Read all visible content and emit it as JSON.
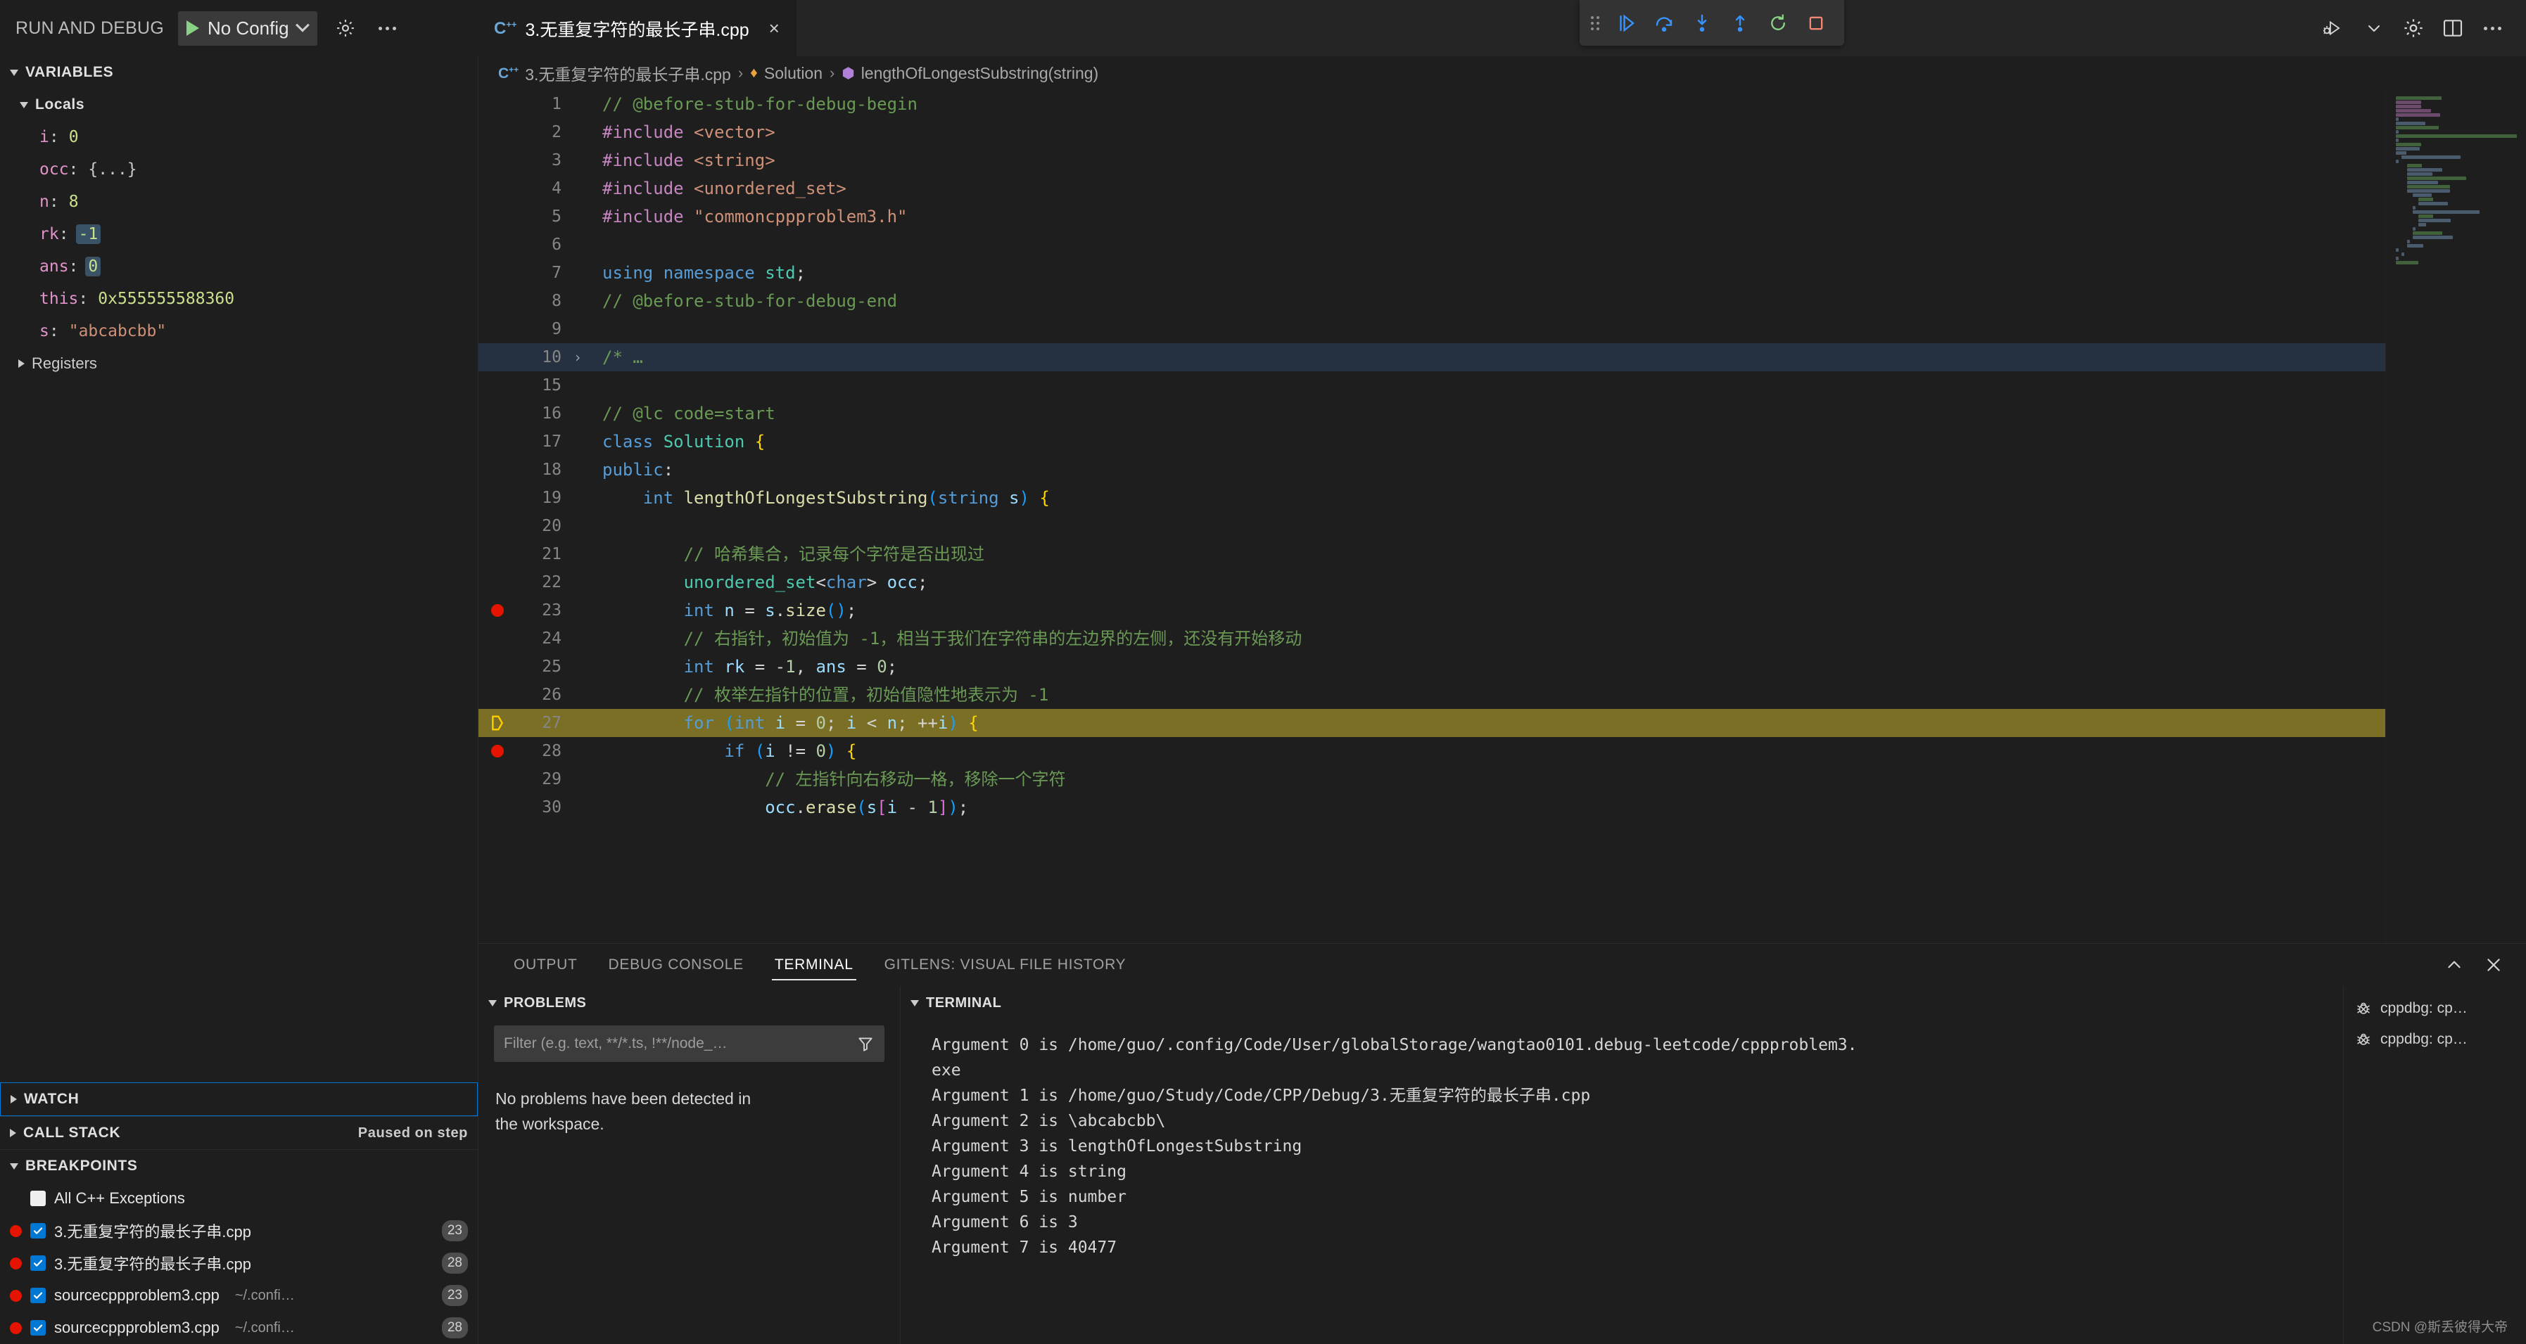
{
  "debug_header": {
    "title": "RUN AND DEBUG",
    "config_label": "No Config",
    "play_icon": "play-icon",
    "gear_icon": "gear-icon",
    "more_icon": "more-actions-icon"
  },
  "tab": {
    "label": "3.无重复字符的最长子串.cpp",
    "icon": "cpp-file-icon",
    "close": "×"
  },
  "debug_toolbar": {
    "buttons": [
      {
        "name": "drag-handle",
        "title": ""
      },
      {
        "name": "continue-button",
        "title": "Continue"
      },
      {
        "name": "step-over-button",
        "title": "Step Over"
      },
      {
        "name": "step-into-button",
        "title": "Step Into"
      },
      {
        "name": "step-out-button",
        "title": "Step Out"
      },
      {
        "name": "restart-button",
        "title": "Restart"
      },
      {
        "name": "stop-button",
        "title": "Stop"
      }
    ]
  },
  "top_right_icons": [
    {
      "name": "run-and-debug-icon"
    },
    {
      "name": "chevron-down-icon"
    },
    {
      "name": "settings-gear-icon"
    },
    {
      "name": "split-editor-icon"
    },
    {
      "name": "more-actions-icon"
    }
  ],
  "sidebar": {
    "variables_title": "VARIABLES",
    "locals_title": "Locals",
    "registers_title": "Registers",
    "locals": [
      {
        "name": "i",
        "value": "0",
        "kind": "num",
        "changed": false
      },
      {
        "name": "occ",
        "value": "{...}",
        "kind": "obj",
        "changed": false
      },
      {
        "name": "n",
        "value": "8",
        "kind": "num",
        "changed": false
      },
      {
        "name": "rk",
        "value": "-1",
        "kind": "num",
        "changed": true
      },
      {
        "name": "ans",
        "value": "0",
        "kind": "num",
        "changed": true
      },
      {
        "name": "this",
        "value": "0x555555588360",
        "kind": "num",
        "changed": false
      },
      {
        "name": "s",
        "value": "\"abcabcbb\"",
        "kind": "str",
        "changed": false
      }
    ],
    "watch_title": "WATCH",
    "callstack_title": "CALL STACK",
    "callstack_status": "Paused on step",
    "breakpoints_title": "BREAKPOINTS",
    "breakpoints": [
      {
        "label": "All C++ Exceptions",
        "path": "",
        "line": "",
        "checked": false,
        "dot": false
      },
      {
        "label": "3.无重复字符的最长子串.cpp",
        "path": "",
        "line": "23",
        "checked": true,
        "dot": true
      },
      {
        "label": "3.无重复字符的最长子串.cpp",
        "path": "",
        "line": "28",
        "checked": true,
        "dot": true
      },
      {
        "label": "sourcecppproblem3.cpp",
        "path": "~/.confi…",
        "line": "23",
        "checked": true,
        "dot": true
      },
      {
        "label": "sourcecppproblem3.cpp",
        "path": "~/.confi…",
        "line": "28",
        "checked": true,
        "dot": true
      }
    ]
  },
  "breadcrumb": {
    "file": "3.无重复字符的最长子串.cpp",
    "klass": "Solution",
    "method": "lengthOfLongestSubstring(string)",
    "sep": "›"
  },
  "code": {
    "lines": [
      {
        "n": "1",
        "bp": false,
        "exec": false,
        "fold": "",
        "hl": false
      },
      {
        "n": "2",
        "bp": false,
        "exec": false,
        "fold": "",
        "hl": false
      },
      {
        "n": "3",
        "bp": false,
        "exec": false,
        "fold": "",
        "hl": false
      },
      {
        "n": "4",
        "bp": false,
        "exec": false,
        "fold": "",
        "hl": false
      },
      {
        "n": "5",
        "bp": false,
        "exec": false,
        "fold": "",
        "hl": false
      },
      {
        "n": "6",
        "bp": false,
        "exec": false,
        "fold": "",
        "hl": false
      },
      {
        "n": "7",
        "bp": false,
        "exec": false,
        "fold": "",
        "hl": false
      },
      {
        "n": "8",
        "bp": false,
        "exec": false,
        "fold": "",
        "hl": false
      },
      {
        "n": "9",
        "bp": false,
        "exec": false,
        "fold": "",
        "hl": false
      },
      {
        "n": "10",
        "bp": false,
        "exec": false,
        "fold": "›",
        "hl": true
      },
      {
        "n": "15",
        "bp": false,
        "exec": false,
        "fold": "",
        "hl": false
      },
      {
        "n": "16",
        "bp": false,
        "exec": false,
        "fold": "",
        "hl": false
      },
      {
        "n": "17",
        "bp": false,
        "exec": false,
        "fold": "",
        "hl": false
      },
      {
        "n": "18",
        "bp": false,
        "exec": false,
        "fold": "",
        "hl": false
      },
      {
        "n": "19",
        "bp": false,
        "exec": false,
        "fold": "",
        "hl": false
      },
      {
        "n": "20",
        "bp": false,
        "exec": false,
        "fold": "",
        "hl": false
      },
      {
        "n": "21",
        "bp": false,
        "exec": false,
        "fold": "",
        "hl": false
      },
      {
        "n": "22",
        "bp": false,
        "exec": false,
        "fold": "",
        "hl": false
      },
      {
        "n": "23",
        "bp": true,
        "exec": false,
        "fold": "",
        "hl": false
      },
      {
        "n": "24",
        "bp": false,
        "exec": false,
        "fold": "",
        "hl": false
      },
      {
        "n": "25",
        "bp": false,
        "exec": false,
        "fold": "",
        "hl": false
      },
      {
        "n": "26",
        "bp": false,
        "exec": false,
        "fold": "",
        "hl": false
      },
      {
        "n": "27",
        "bp": false,
        "exec": true,
        "fold": "",
        "hl": false
      },
      {
        "n": "28",
        "bp": true,
        "exec": false,
        "fold": "",
        "hl": false
      },
      {
        "n": "29",
        "bp": false,
        "exec": false,
        "fold": "",
        "hl": false
      },
      {
        "n": "30",
        "bp": false,
        "exec": false,
        "fold": "",
        "hl": false
      }
    ],
    "text": [
      "// @before-stub-for-debug-begin",
      "#include <vector>",
      "#include <string>",
      "#include <unordered_set>",
      "#include \"commoncppproblem3.h\"",
      "",
      "using namespace std;",
      "// @before-stub-for-debug-end",
      "",
      "/* …",
      "",
      "// @lc code=start",
      "class Solution {",
      "public:",
      "    int lengthOfLongestSubstring(string s) {",
      "",
      "        // 哈希集合，记录每个字符是否出现过",
      "        unordered_set<char> occ;",
      "        int n = s.size();",
      "        // 右指针，初始值为 -1，相当于我们在字符串的左边界的左侧，还没有开始移动",
      "        int rk = -1, ans = 0;",
      "        // 枚举左指针的位置，初始值隐性地表示为 -1",
      "        for (int i = 0; i < n; ++i) {",
      "            if (i != 0) {",
      "                // 左指针向右移动一格，移除一个字符",
      "                occ.erase(s[i - 1]);"
    ]
  },
  "panel": {
    "tabs": [
      {
        "label": "OUTPUT",
        "active": false
      },
      {
        "label": "DEBUG CONSOLE",
        "active": false
      },
      {
        "label": "TERMINAL",
        "active": true
      },
      {
        "label": "GITLENS: VISUAL FILE HISTORY",
        "active": false
      }
    ],
    "chevron_up_icon": "chevron-up-icon",
    "close_icon": "close-panel-icon",
    "problems_title": "PROBLEMS",
    "terminal_title": "TERMINAL",
    "filter_placeholder": "Filter (e.g. text, **/*.ts, !**/node_…",
    "filter_value": "",
    "filter_icon": "filter-icon",
    "no_problems": "No problems have been detected in the workspace."
  },
  "terminal": {
    "lines": [
      "Argument 0 is /home/guo/.config/Code/User/globalStorage/wangtao0101.debug-leetcode/cppproblem3.",
      "exe",
      "Argument 1 is /home/guo/Study/Code/CPP/Debug/3.无重复字符的最长子串.cpp",
      "Argument 2 is \\abcabcbb\\",
      "Argument 3 is lengthOfLongestSubstring",
      "Argument 4 is string",
      "Argument 5 is number",
      "Argument 6 is 3",
      "Argument 7 is 40477"
    ],
    "list": [
      {
        "label": "cppdbg: cp…",
        "icon": "debug-bug-icon"
      },
      {
        "label": "cppdbg: cp…",
        "icon": "debug-bug-icon"
      }
    ]
  },
  "watermark": "CSDN @斯丢彼得大帝",
  "colors": {
    "accent": "#0078d4",
    "breakpoint": "#e51400",
    "exec_line": "#7a6f24",
    "play": "#89d185",
    "stop": "#f48771"
  }
}
